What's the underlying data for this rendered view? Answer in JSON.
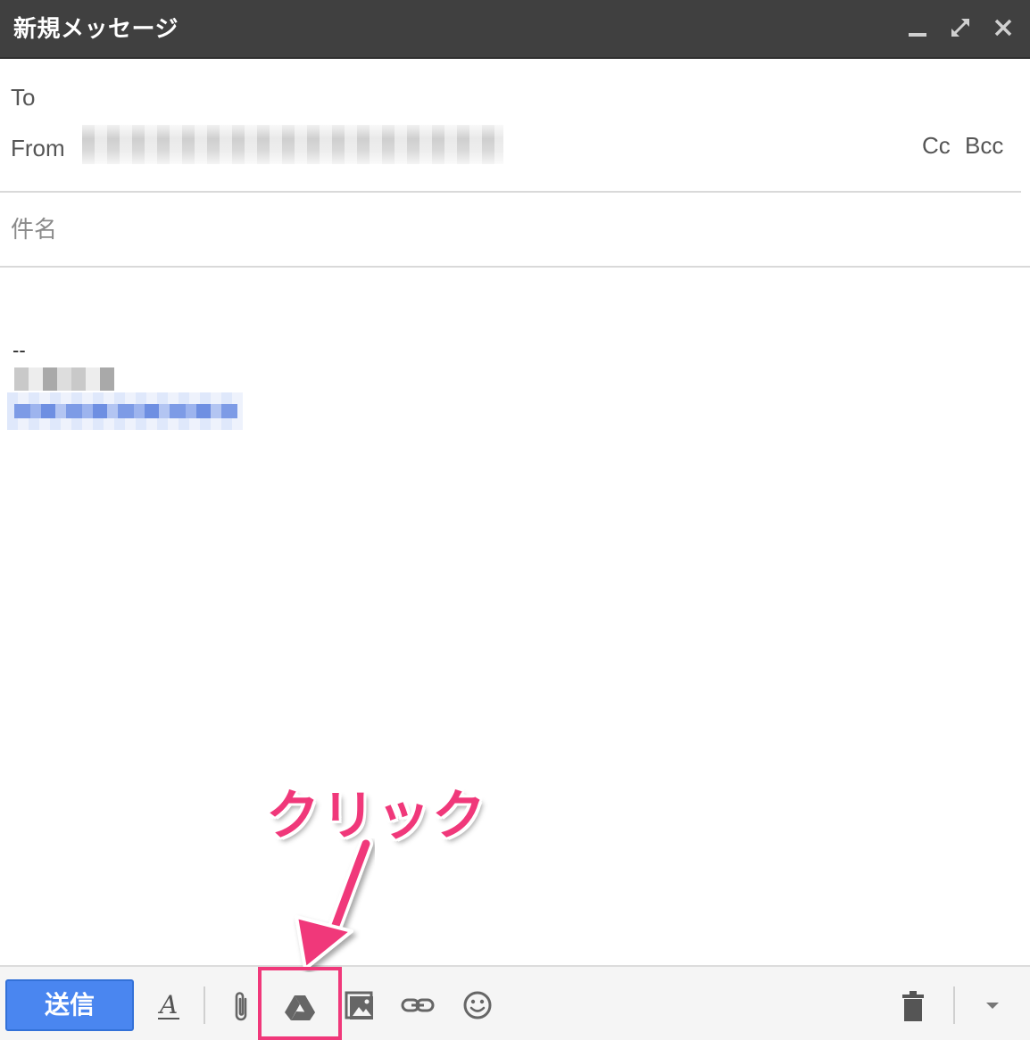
{
  "window": {
    "title": "新規メッセージ",
    "minimize_icon": "minimize-icon",
    "expand_icon": "expand-icon",
    "close_icon": "close-icon"
  },
  "header": {
    "to_label": "To",
    "from_label": "From",
    "cc_label": "Cc",
    "bcc_label": "Bcc"
  },
  "subject": {
    "placeholder": "件名",
    "value": ""
  },
  "body": {
    "signature_dashes": "--"
  },
  "toolbar": {
    "send_label": "送信",
    "send_color": "#4a86f0",
    "format_icon": "text-format-icon",
    "attach_icon": "paperclip-icon",
    "drive_icon": "google-drive-icon",
    "photo_icon": "insert-photo-icon",
    "link_icon": "link-icon",
    "emoji_icon": "emoji-icon",
    "trash_icon": "trash-icon",
    "more_icon": "dropdown-arrow-icon"
  },
  "annotation": {
    "text": "クリック",
    "color": "#f0387a"
  }
}
